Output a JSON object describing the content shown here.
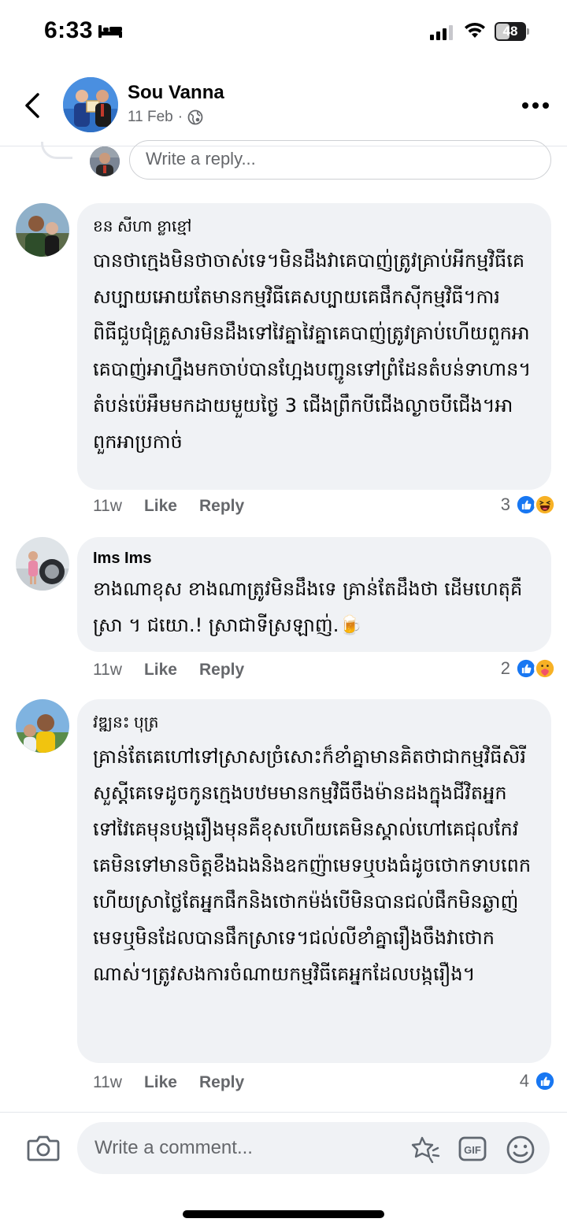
{
  "status_bar": {
    "time": "6:33",
    "battery": "48",
    "battery_level": 0.48
  },
  "header": {
    "name": "Sou Vanna",
    "date": "11 Feb",
    "separator": "·"
  },
  "reply_box": {
    "placeholder": "Write a reply..."
  },
  "comments": [
    {
      "author": "ខន សីហា ខ្លាខ្មៅ",
      "text": "បានថាក្មេងមិនថាចាស់ទេ។មិនដឹងវាគេបាញ់ត្រូវគ្រាប់អីកម្មវិធីគេសប្បាយអោយតែមានកម្មវិធីគេសប្បាយគេផឹកស៊ីកម្មវិធី។ការពិធីជួបជុំគ្រួសារមិនដឹងទៅវៃគ្នាវៃគ្នាគេបាញ់ត្រូវគ្រាប់ហើយពួកអាគេបាញ់អាហ្នឹងមកចាប់បានហ្អែងបញ្ជូនទៅព្រំដែនតំបន់ទាហាន។តំបន់ប៉េអឹមមកដាយមួយថ្ងៃ 3 ជើងព្រឹកបីជើងល្ងាចបីជើង។អាពួកអាប្រកាច់",
      "time": "11w",
      "like": "Like",
      "reply": "Reply",
      "reaction_count": "3",
      "reactions": [
        "like",
        "haha"
      ]
    },
    {
      "author": "Ims Ims",
      "text": "ខាងណាខុស ខាងណាត្រូវមិនដឹងទេ គ្រាន់តែដឹងថា ដើមហេតុគឺស្រា ។ ជយោ.! ស្រាជាទីស្រឡាញ់.",
      "emoji": "🍺",
      "time": "11w",
      "like": "Like",
      "reply": "Reply",
      "reaction_count": "2",
      "reactions": [
        "like",
        "care"
      ]
    },
    {
      "author": "វឌ្ឍនះ បុត្រ",
      "text": "គ្រាន់តែគេហៅទៅស្រាសច្រំសោះក៏ខាំគ្នាមានគិតថាជាកម្មវិធីសិរីសួស្ដីគេទេដូចកូនក្មេងបឋមមានកម្មវិធីចឹងម៉ានដងក្នុងជីវិតអ្នកទៅវៃគេមុនបង្ករឿងមុនគឺខុសហើយគេមិនស្គាល់ហៅគេជុលកែវគេមិនទៅមានចិត្តខឹងឯងនិងឧកញ៉ាមេទឬបងធំដូចថោកទាបពេកហើយស្រាថ្លៃតែអ្នកផឹកនិងថោកម៉ង់បើមិនបានជល់ផឹកមិនឆ្ងាញ់មេទឬមិនដែលបានផឹកស្រាទេ។ជល់លីខាំគ្នារឿងចឹងវាថោកណាស់។ត្រូវសងការចំណាយកម្មវិធីគេអ្នកដែលបង្ករឿង។",
      "time": "11w",
      "like": "Like",
      "reply": "Reply",
      "reaction_count": "4",
      "reactions": [
        "like"
      ]
    }
  ],
  "composer": {
    "placeholder": "Write a comment...",
    "gif_label": "GIF"
  },
  "colors": {
    "like_blue": "#1877f2",
    "haha_yellow": "#f7b125",
    "bubble_bg": "#f0f2f5",
    "secondary_text": "#65676b"
  },
  "icons": [
    "back-arrow-icon",
    "globe-icon",
    "more-icon",
    "camera-icon",
    "sticker-icon",
    "gif-icon",
    "emoji-icon",
    "like-reaction-icon",
    "haha-reaction-icon",
    "care-reaction-icon"
  ]
}
